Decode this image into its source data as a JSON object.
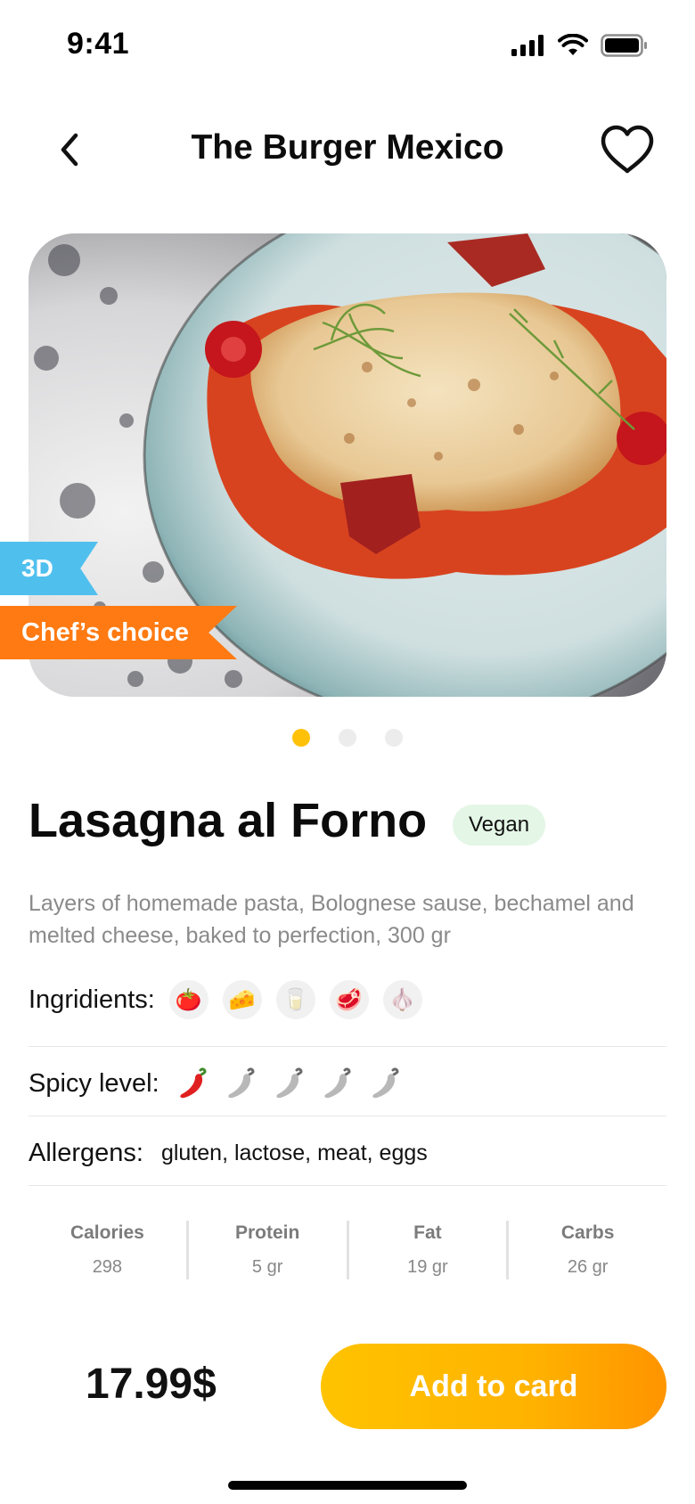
{
  "status_bar": {
    "time": "9:41"
  },
  "header": {
    "title": "The Burger Mexico",
    "back_icon": "chevron-left-icon",
    "favorite_icon": "heart-icon"
  },
  "hero": {
    "badges": {
      "three_d": "3D",
      "chefs_choice": "Chef’s choice"
    },
    "carousel": {
      "count": 3,
      "active_index": 0
    }
  },
  "product": {
    "name": "Lasagna al Forno",
    "tag": "Vegan",
    "description": "Layers of homemade pasta, Bolognese sause, bechamel and melted cheese, baked to perfection, 300 gr",
    "ingredients_label": "Ingridients:",
    "ingredients": [
      {
        "icon": "tomato-icon",
        "glyph": "🍅"
      },
      {
        "icon": "cheese-icon",
        "glyph": "🧀"
      },
      {
        "icon": "milk-icon",
        "glyph": "🥛"
      },
      {
        "icon": "meat-icon",
        "glyph": "🥩"
      },
      {
        "icon": "garlic-icon",
        "glyph": "🧄"
      }
    ],
    "spicy_label": "Spicy level:",
    "spicy": {
      "level": 1,
      "max": 5
    },
    "allergens_label": "Allergens:",
    "allergens": "gluten, lactose, meat, eggs"
  },
  "nutrition": [
    {
      "label": "Calories",
      "value": "298"
    },
    {
      "label": "Protein",
      "value": "5 gr"
    },
    {
      "label": "Fat",
      "value": "19 gr"
    },
    {
      "label": "Carbs",
      "value": "26 gr"
    }
  ],
  "footer": {
    "price": "17.99$",
    "add_button": "Add to card"
  },
  "colors": {
    "accent": "#ffc107",
    "cta_gradient_end": "#ff9400",
    "badge_3d": "#4fc0ee",
    "badge_chef": "#ff7a12",
    "vegan_bg": "#e4f6e6",
    "pepper_active": "#e02020",
    "pepper_inactive": "#b8b8b8"
  }
}
